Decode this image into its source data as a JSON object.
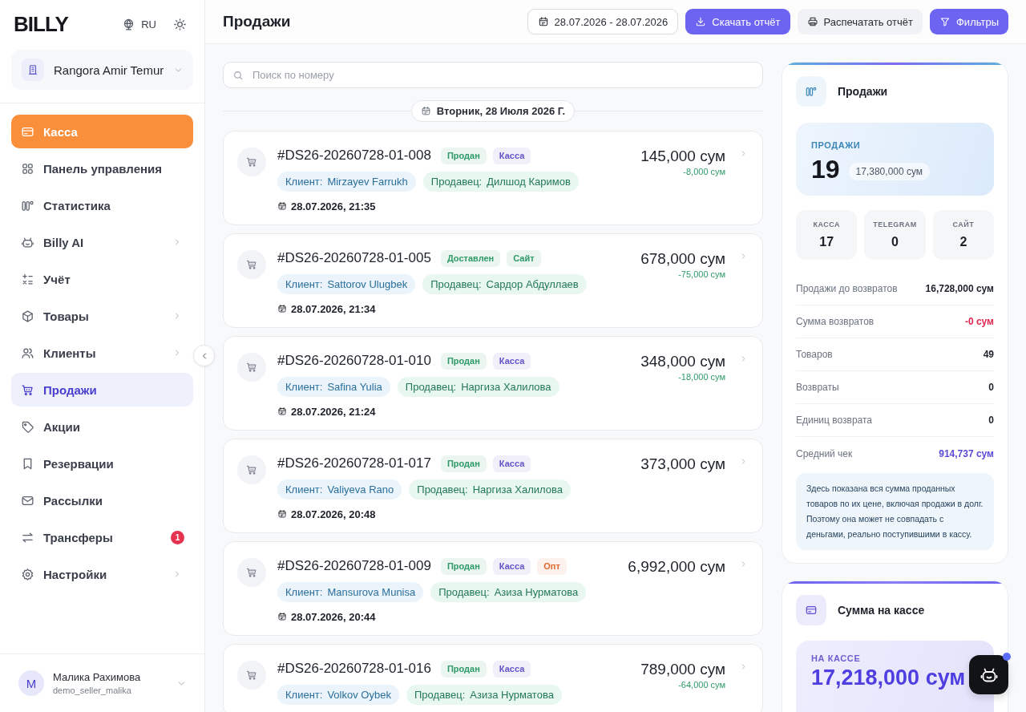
{
  "sidebar": {
    "logo": "BILLY",
    "language": "RU",
    "store": {
      "name": "Rangora Amir Temur"
    },
    "nav": [
      {
        "label": "Касса",
        "kind": "action",
        "selected": false,
        "submenu": false
      },
      {
        "label": "Панель управления",
        "kind": "link",
        "selected": false,
        "submenu": false
      },
      {
        "label": "Статистика",
        "kind": "link",
        "selected": false,
        "submenu": false
      },
      {
        "label": "Billy AI",
        "kind": "link",
        "selected": false,
        "submenu": true
      },
      {
        "label": "Учёт",
        "kind": "link",
        "selected": false,
        "submenu": false
      },
      {
        "label": "Товары",
        "kind": "link",
        "selected": false,
        "submenu": true
      },
      {
        "label": "Клиенты",
        "kind": "link",
        "selected": false,
        "submenu": true
      },
      {
        "label": "Продажи",
        "kind": "link",
        "selected": true,
        "submenu": false
      },
      {
        "label": "Акции",
        "kind": "link",
        "selected": false,
        "submenu": false
      },
      {
        "label": "Резервации",
        "kind": "link",
        "selected": false,
        "submenu": false
      },
      {
        "label": "Рассылки",
        "kind": "link",
        "selected": false,
        "submenu": false
      },
      {
        "label": "Трансферы",
        "kind": "link",
        "selected": false,
        "submenu": false,
        "badge": "1"
      },
      {
        "label": "Настройки",
        "kind": "link",
        "selected": false,
        "submenu": true
      }
    ],
    "user": {
      "avatar_letter": "М",
      "name": "Малика Рахимова",
      "username": "demo_seller_malika"
    }
  },
  "header": {
    "title": "Продажи",
    "date_range": "28.07.2026 - 28.07.2026",
    "buttons": [
      {
        "label": "Скачать отчёт",
        "kind": "primary"
      },
      {
        "label": "Распечатать отчёт",
        "kind": "secondary"
      },
      {
        "label": "Фильтры",
        "kind": "primary"
      }
    ]
  },
  "search": {
    "placeholder": "Поиск по номеру"
  },
  "day_label": "Вторник, 28 Июля 2026 Г.",
  "sales": [
    {
      "number": "#DS26-20260728-01-008",
      "tags": [
        {
          "label": "Продан",
          "color": "#2e9a67"
        },
        {
          "label": "Касса",
          "color": "#5f55c9"
        }
      ],
      "client_label": "Клиент:",
      "client": "Mirzayev Farrukh",
      "seller_label": "Продавец:",
      "seller": "Дилшод Каримов",
      "datetime": "28.07.2026, 21:35",
      "amount": "145,000 сум",
      "discount": "-8,000 сум"
    },
    {
      "number": "#DS26-20260728-01-005",
      "tags": [
        {
          "label": "Доставлен",
          "color": "#2e9a67"
        },
        {
          "label": "Сайт",
          "color": "#2e9a67"
        }
      ],
      "client_label": "Клиент:",
      "client": "Sattorov Ulugbek",
      "seller_label": "Продавец:",
      "seller": "Сардор Абдуллаев",
      "datetime": "28.07.2026, 21:34",
      "amount": "678,000 сум",
      "discount": "-75,000 сум"
    },
    {
      "number": "#DS26-20260728-01-010",
      "tags": [
        {
          "label": "Продан",
          "color": "#2e9a67"
        },
        {
          "label": "Касса",
          "color": "#5f55c9"
        }
      ],
      "client_label": "Клиент:",
      "client": "Safina Yulia",
      "seller_label": "Продавец:",
      "seller": "Наргиза Халилова",
      "datetime": "28.07.2026, 21:24",
      "amount": "348,000 сум",
      "discount": "-18,000 сум"
    },
    {
      "number": "#DS26-20260728-01-017",
      "tags": [
        {
          "label": "Продан",
          "color": "#2e9a67"
        },
        {
          "label": "Касса",
          "color": "#5f55c9"
        }
      ],
      "client_label": "Клиент:",
      "client": "Valiyeva Rano",
      "seller_label": "Продавец:",
      "seller": "Наргиза Халилова",
      "datetime": "28.07.2026, 20:48",
      "amount": "373,000 сум"
    },
    {
      "number": "#DS26-20260728-01-009",
      "tags": [
        {
          "label": "Продан",
          "color": "#2e9a67"
        },
        {
          "label": "Касса",
          "color": "#5f55c9"
        },
        {
          "label": "Опт",
          "color": "#e0682c"
        }
      ],
      "client_label": "Клиент:",
      "client": "Mansurova Munisa",
      "seller_label": "Продавец:",
      "seller": "Азиза Нурматова",
      "datetime": "28.07.2026, 20:44",
      "amount": "6,992,000 сум"
    },
    {
      "number": "#DS26-20260728-01-016",
      "tags": [
        {
          "label": "Продан",
          "color": "#2e9a67"
        },
        {
          "label": "Касса",
          "color": "#5f55c9"
        }
      ],
      "client_label": "Клиент:",
      "client": "Volkov Oybek",
      "seller_label": "Продавец:",
      "seller": "Азиза Нурматова",
      "amount": "789,000 сум",
      "discount": "-64,000 сум"
    }
  ],
  "summary": {
    "title": "Продажи",
    "highlight": {
      "label": "ПРОДАЖИ",
      "count": "19",
      "amount": "17,380,000 сум"
    },
    "channels": [
      {
        "label": "КАССА",
        "value": "17"
      },
      {
        "label": "TELEGRAM",
        "value": "0"
      },
      {
        "label": "САЙТ",
        "value": "2"
      }
    ],
    "rows": [
      {
        "label": "Продажи до возвратов",
        "value": "16,728,000 сум",
        "kind": "plain"
      },
      {
        "label": "Сумма возвратов",
        "value": "-0 сум",
        "kind": "negative"
      },
      {
        "label": "Товаров",
        "value": "49",
        "kind": "plain"
      },
      {
        "label": "Возвраты",
        "value": "0",
        "kind": "plain"
      },
      {
        "label": "Единиц возврата",
        "value": "0",
        "kind": "plain"
      },
      {
        "label": "Средний чек",
        "value": "914,737 сум",
        "kind": "accent"
      }
    ],
    "note": "Здесь показана вся сумма проданных товаров по их цене, включая продажи в долг. Поэтому она может не совпадать с деньгами, реально поступившими в кассу."
  },
  "cash": {
    "title": "Сумма на кассе",
    "label": "НА КАССЕ",
    "amount": "17,218,000 сум"
  }
}
